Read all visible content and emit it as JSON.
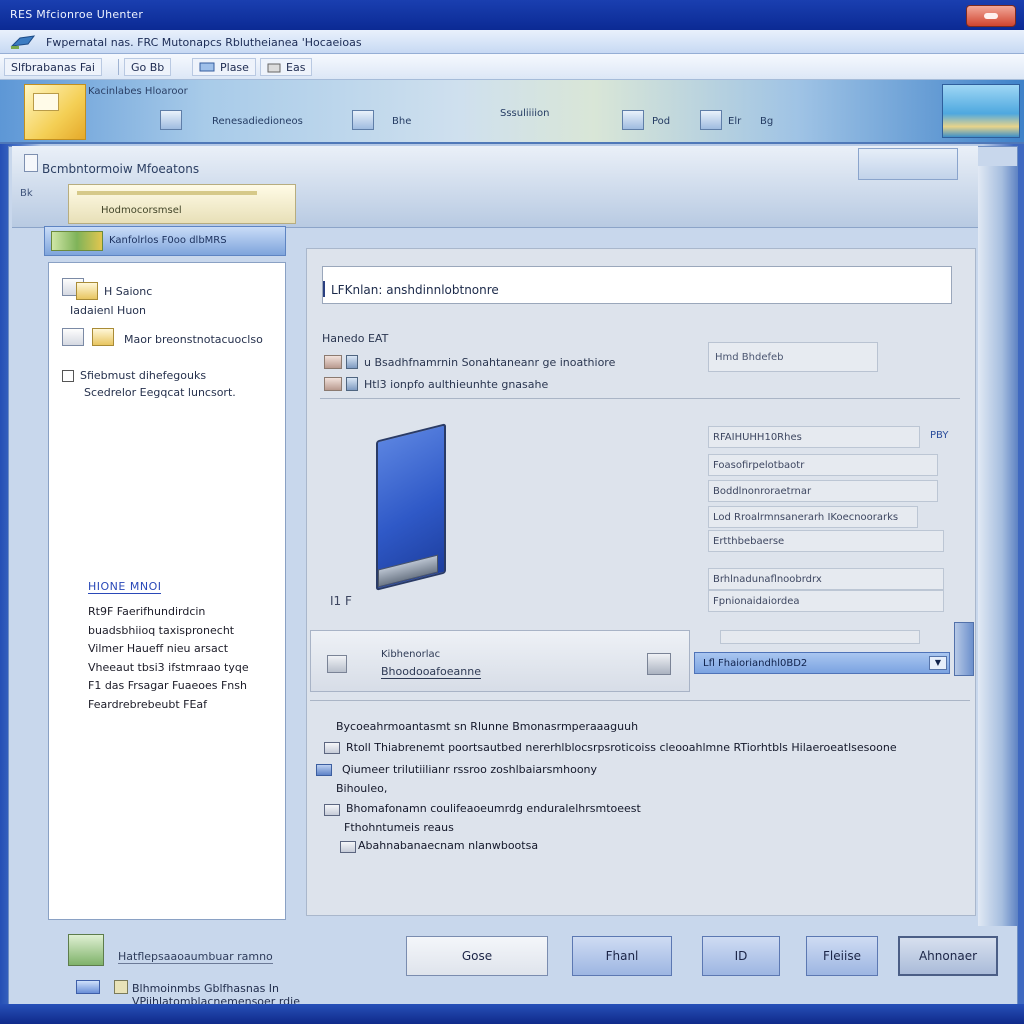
{
  "window": {
    "title": "RES Mfcionroe Uhenter"
  },
  "menubar": {
    "text": "Fwpernatal nas. FRC Mutonapcs Rblutheianea 'Hocaeioas"
  },
  "toolbar": {
    "items": [
      "Slfbrabanas Fai",
      "Go Bb",
      "Plase",
      "Eas"
    ]
  },
  "banner": {
    "title": "Kacinlabes Hloaroor",
    "labels": [
      "Renesadiedioneos",
      "Bhe",
      "Sssuliiiion",
      "Pod",
      "Elr",
      "Bg"
    ]
  },
  "app": {
    "head_title": "Bcmbntormoiw Mfoeatons",
    "back_label": "Bk",
    "tab_text": "Hodmocorsmsel"
  },
  "left_panel": {
    "header": "Kanfolrlos F0oo dlbMRS",
    "rows": [
      {
        "line1": "H  Saionc",
        "line2": "Iadaienl Huon"
      },
      {
        "line1": "Maor breonstnotacuoclso"
      }
    ],
    "check_row": {
      "line1": "Sfiebmust dihefegouks",
      "line2": "Scedrelor Eegqcat luncsort."
    },
    "heading": "HIONE MNOI",
    "paragraph": [
      "Rt9F Faerifhundirdcin",
      "buadsbhiioq  taxispronecht",
      "Vilmer Haueff nieu arsact",
      "Vheeaut tbsi3 ifstmraao tyqe",
      "F1 das Frsagar Fuaeoes Fnsh",
      "Feardrebrebeubt  FEaf"
    ]
  },
  "content": {
    "path": "LFKnlan: anshdinnlobtnonre",
    "section_label": "Hanedo EAT",
    "options": [
      "u Bsadhfnamrnin Sonahtaneanr ge inoathiore",
      "Htl3 ionpfo aulthieunhte gnasahe"
    ],
    "ghost_input": "Hmd Bhdefeb",
    "specs": [
      "RFAIHUHH10Rhes",
      "Foasofirpelotbaotr",
      "Boddlnonroraetrnar",
      "Lod Rroalrmnsanerarh IKoecnoorarks",
      "Ertthbebaerse",
      "Brhlnadunaflnoobrdrx",
      "Fpnionaidaiordea"
    ],
    "spec_badge": "PBY",
    "monitor_label": "I1 F",
    "driver": {
      "line1": "Kibhenorlac",
      "line2": "Bhoodooafoeanne"
    },
    "select_value": "Lfl Fhaioriandhl0BD2",
    "log": [
      "Bycoeahrmoantasmt sn  Rlunne  Bmonasrmperaaaguuh",
      "Rtoll Thiabrenemt  poortsautbed nererhlblocsrpsroticoiss cleooahlmne  RTiorhtbls  Hilaeroeatlsesoone",
      "Qiumeer trilutiilianr rssroo   zoshlbaiarsmhoony",
      "Bihouleo,",
      "Bhomafonamn coulifeaoeumrdg  enduralelhrsmtoeest",
      "Fthohntumeis reaus",
      "Abahnabanaecnam nlanwbootsa"
    ]
  },
  "buttons": {
    "close": "Gose",
    "back": "Fhanl",
    "next": "ID",
    "help": "Fleiise",
    "advanced": "Ahnonaer"
  },
  "status": {
    "title": "Hatflepsaaoaumbuar ramno",
    "text": "Blhmoinmbs  Gblfhasnas In VPiihlatomblacnemensoer rdie"
  }
}
